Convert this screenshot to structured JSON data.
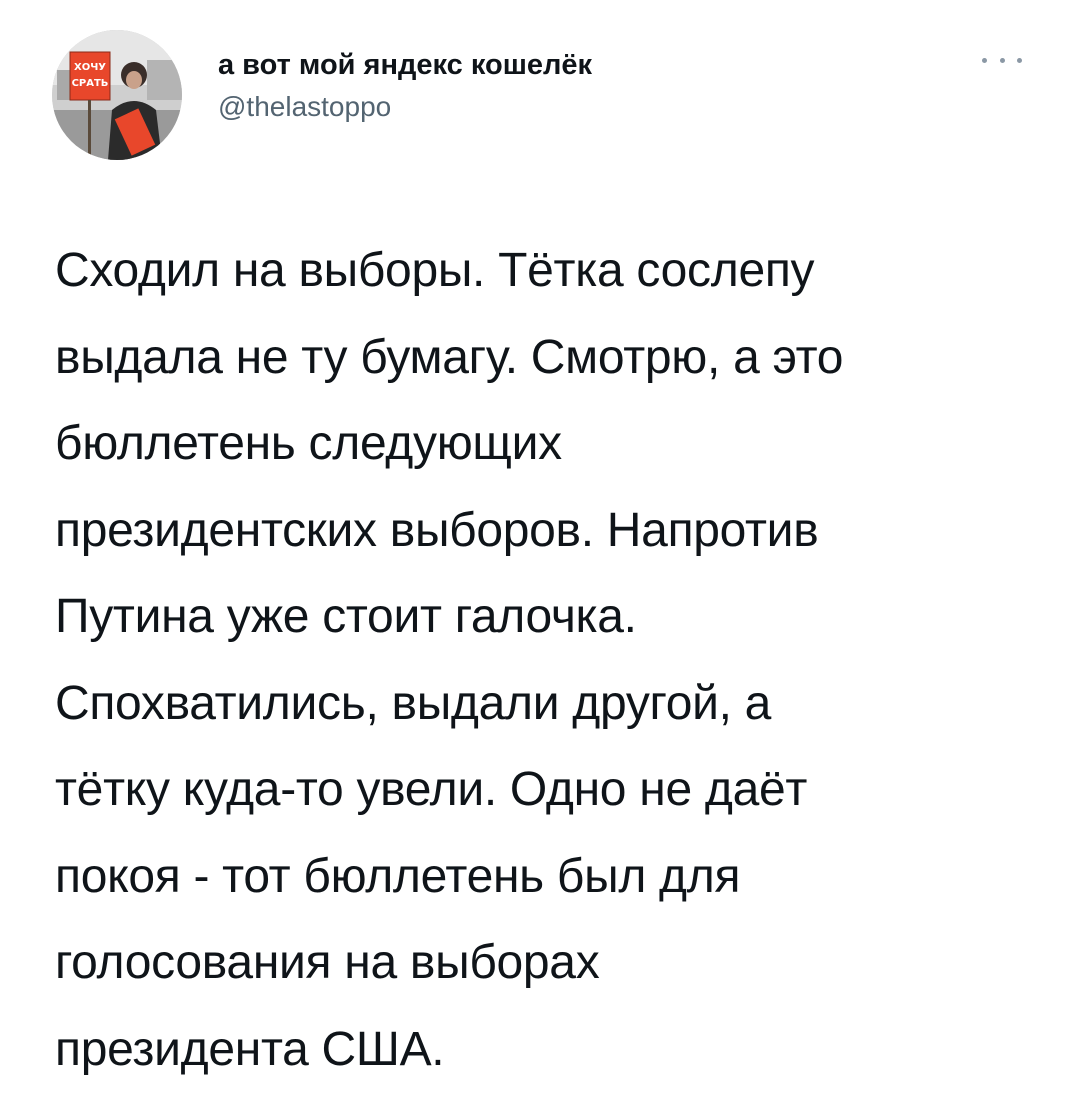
{
  "tweet": {
    "author": {
      "display_name": "а вот мой яндекс кошелёк",
      "handle": "@thelastoppo",
      "avatar": {
        "icon": "profile-photo-icon",
        "sign_text": [
          "ХОЧУ",
          "СРАТЬ"
        ],
        "accent_color": "#e8472b"
      }
    },
    "menu": {
      "icon": "more-options-icon"
    },
    "text": "Сходил на выборы. Тётка сослепу\nвыдала не ту бумагу. Смотрю, а это\nбюллетень следующих\nпрезидентских выборов. Напротив\nПутина уже стоит галочка.\nСпохватились, выдали другой, а\nтётку куда-то увели. Одно не даёт\nпокоя - тот бюллетень был для\nголосования на выборах\nпрезидента США."
  }
}
